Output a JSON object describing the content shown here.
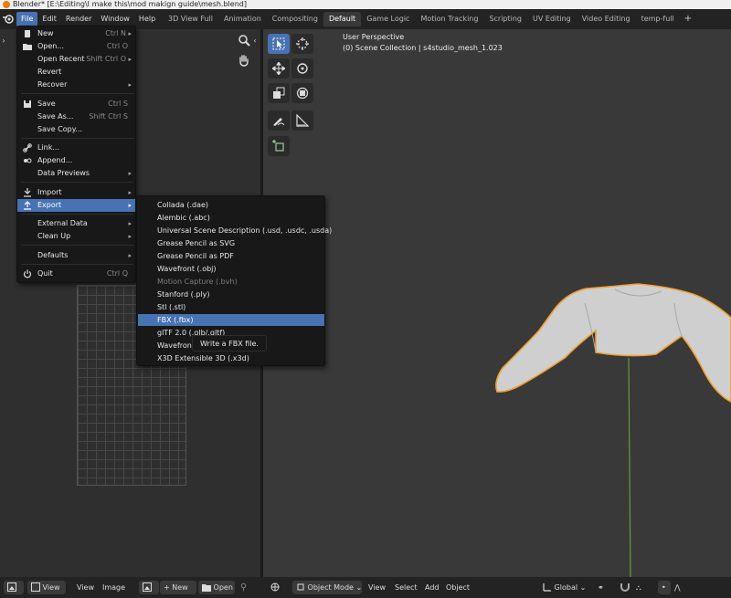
{
  "window": {
    "title": "Blender* [E:\\Editing\\I make this\\mod makign guide\\mesh.blend]"
  },
  "menubar": {
    "items": [
      "File",
      "Edit",
      "Render",
      "Window",
      "Help"
    ]
  },
  "workspaces": {
    "tabs": [
      "3D View Full",
      "Animation",
      "Compositing",
      "Default",
      "Game Logic",
      "Motion Tracking",
      "Scripting",
      "UV Editing",
      "Video Editing",
      "temp-full"
    ],
    "active": "Default",
    "add_label": "+"
  },
  "viewport": {
    "perspective": "User Perspective",
    "collection": "(0) Scene Collection | s4studio_mesh_1.023",
    "outline_color": "#f0a030",
    "axis_color": "#6a9a3a"
  },
  "file_menu": {
    "items": [
      {
        "label": "New",
        "shortcut": "Ctrl N",
        "arrow": "▸",
        "icon": "new-file-icon"
      },
      {
        "label": "Open...",
        "shortcut": "Ctrl O",
        "icon": "open-folder-icon"
      },
      {
        "label": "Open Recent",
        "shortcut": "Shift Ctrl O",
        "arrow": "▸"
      },
      {
        "label": "Revert"
      },
      {
        "label": "Recover",
        "arrow": "▸"
      },
      {
        "label": "Save",
        "shortcut": "Ctrl S",
        "icon": "save-file-icon"
      },
      {
        "label": "Save As...",
        "shortcut": "Shift Ctrl S"
      },
      {
        "label": "Save Copy..."
      },
      {
        "label": "Link...",
        "icon": "link-icon"
      },
      {
        "label": "Append...",
        "icon": "append-icon"
      },
      {
        "label": "Data Previews",
        "arrow": "▸"
      },
      {
        "label": "Import",
        "arrow": "▸",
        "icon": "import-icon"
      },
      {
        "label": "Export",
        "arrow": "▸",
        "icon": "export-icon"
      },
      {
        "label": "External Data",
        "arrow": "▸"
      },
      {
        "label": "Clean Up",
        "arrow": "▸"
      },
      {
        "label": "Defaults",
        "arrow": "▸"
      },
      {
        "label": "Quit",
        "shortcut": "Ctrl Q",
        "icon": "power-icon"
      }
    ]
  },
  "export_menu": {
    "items": [
      {
        "label": "Collada (.dae)"
      },
      {
        "label": "Alembic (.abc)"
      },
      {
        "label": "Universal Scene Description (.usd, .usdc, .usda)"
      },
      {
        "label": "Grease Pencil as SVG"
      },
      {
        "label": "Grease Pencil as PDF"
      },
      {
        "label": "Wavefront (.obj)"
      },
      {
        "label": "Motion Capture (.bvh)",
        "disabled": true
      },
      {
        "label": "Stanford (.ply)"
      },
      {
        "label": "Stl (.stl)"
      },
      {
        "label": "FBX (.fbx)",
        "highlighted": true
      },
      {
        "label": "glTF 2.0 (.glb/.gltf)"
      },
      {
        "label": "Wavefront"
      },
      {
        "label": "X3D Extensible 3D (.x3d)"
      }
    ],
    "tooltip": "Write a FBX file."
  },
  "bottombar": {
    "left": {
      "view_label": "View",
      "view2_label": "View",
      "image_label": "Image",
      "new_label": "New",
      "open_label": "Open"
    },
    "right": {
      "mode_label": "Object Mode",
      "view_label": "View",
      "select_label": "Select",
      "add_label": "Add",
      "object_label": "Object",
      "orientation_label": "Global"
    }
  }
}
